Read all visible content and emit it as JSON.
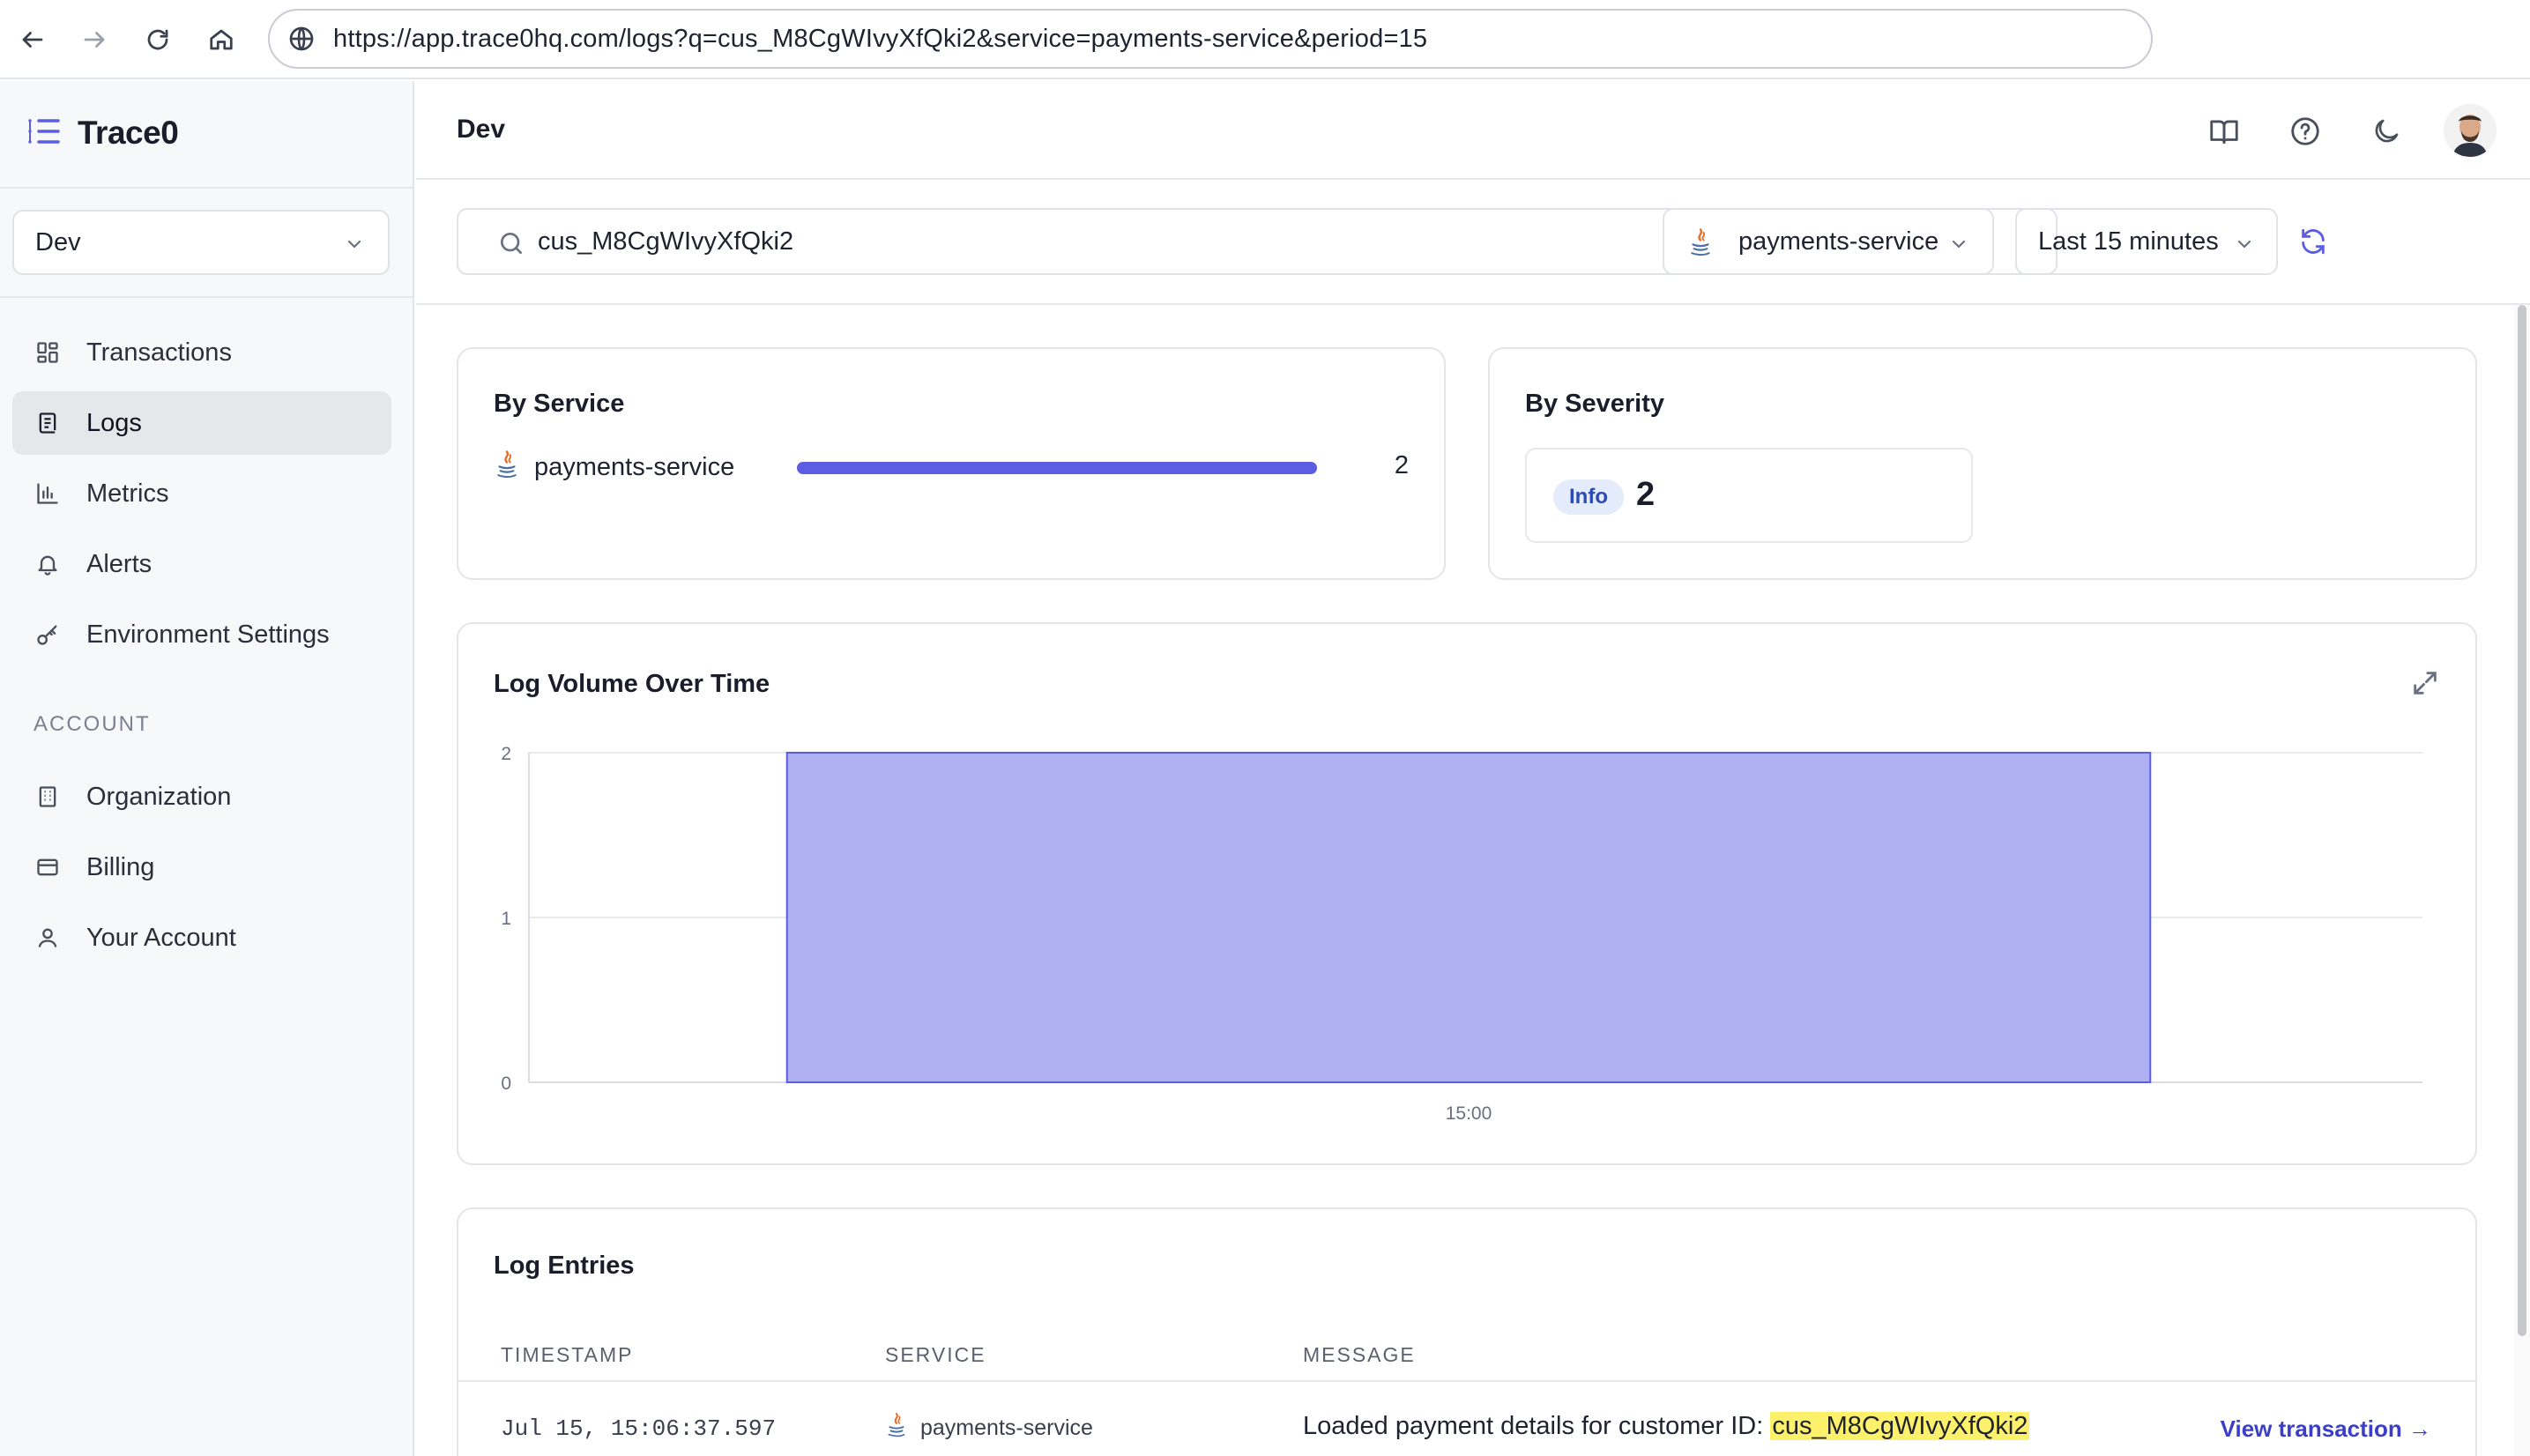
{
  "browser": {
    "url": "https://app.trace0hq.com/logs?q=cus_M8CgWIvyXfQki2&service=payments-service&period=15"
  },
  "sidebar": {
    "brand": "Trace0",
    "environment": "Dev",
    "items": [
      {
        "label": "Transactions",
        "icon": "grid-icon"
      },
      {
        "label": "Logs",
        "icon": "logs-icon",
        "active": true
      },
      {
        "label": "Metrics",
        "icon": "chart-icon"
      },
      {
        "label": "Alerts",
        "icon": "bell-icon"
      },
      {
        "label": "Environment Settings",
        "icon": "key-icon"
      }
    ],
    "account_label": "ACCOUNT",
    "account_items": [
      {
        "label": "Organization",
        "icon": "building-icon"
      },
      {
        "label": "Billing",
        "icon": "card-icon"
      },
      {
        "label": "Your Account",
        "icon": "user-icon"
      }
    ]
  },
  "header": {
    "title": "Dev"
  },
  "filters": {
    "search_value": "cus_M8CgWIvyXfQki2",
    "service": "payments-service",
    "period": "Last 15 minutes"
  },
  "by_service": {
    "title": "By Service",
    "rows": [
      {
        "name": "payments-service",
        "count": "2",
        "fraction": 1.0
      }
    ]
  },
  "by_severity": {
    "title": "By Severity",
    "rows": [
      {
        "level": "Info",
        "count": "2"
      }
    ]
  },
  "volume": {
    "title": "Log Volume Over Time"
  },
  "chart_data": {
    "type": "area",
    "title": "Log Volume Over Time",
    "x_ticks": [
      "15:00"
    ],
    "y_ticks": [
      "0",
      "1",
      "2"
    ],
    "ylim": [
      0,
      2
    ],
    "series": [
      {
        "values": [
          2
        ]
      }
    ],
    "grid": true,
    "color": "#aeb0f2",
    "stroke": "#5b5ee2"
  },
  "entries": {
    "title": "Log Entries",
    "columns": [
      "TIMESTAMP",
      "SERVICE",
      "MESSAGE"
    ],
    "rows": [
      {
        "timestamp": "Jul 15, 15:06:37.597",
        "service": "payments-service",
        "message_prefix": "Loaded payment details for customer ID: ",
        "message_highlight": "cus_M8CgWIvyXfQki2",
        "action": "View transaction →"
      }
    ]
  },
  "colors": {
    "accent": "#5b5ee2",
    "link": "#3b3fc7",
    "highlight": "#fdf06b"
  }
}
